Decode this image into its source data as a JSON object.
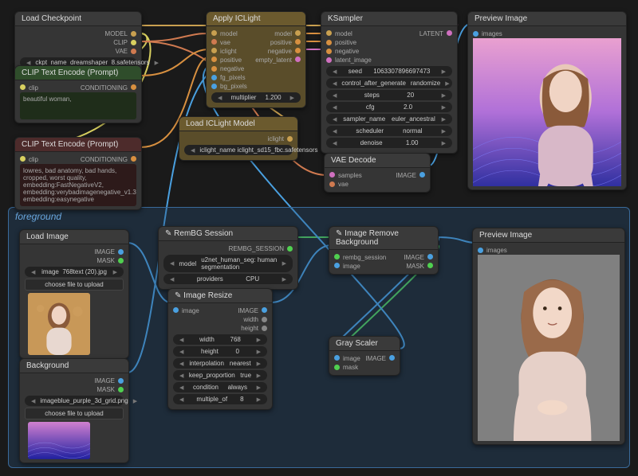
{
  "group": {
    "title": "foreground"
  },
  "loadCheckpoint": {
    "title": "Load Checkpoint",
    "outputs": [
      "MODEL",
      "CLIP",
      "VAE"
    ],
    "widget_label": "ckpt_name",
    "widget_value": "dreamshaper_8.safetensors"
  },
  "clipPos": {
    "title": "CLIP Text Encode (Prompt)",
    "in": "clip",
    "out": "CONDITIONING",
    "text": "beautiful woman,"
  },
  "clipNeg": {
    "title": "CLIP Text Encode (Prompt)",
    "in": "clip",
    "out": "CONDITIONING",
    "text": "lowres, bad anatomy, bad hands, cropped, worst quality, embedding:FastNegativeV2, embedding:verybadimagenegative_v1.3, embedding:easynegative"
  },
  "applyIC": {
    "title": "Apply ICLight",
    "left": [
      "model",
      "vae",
      "iclight",
      "positive",
      "negative",
      "fg_pixels",
      "bg_pixels"
    ],
    "right": [
      "model",
      "positive",
      "negative",
      "empty_latent"
    ],
    "mult_label": "multiplier",
    "mult_value": "1.200"
  },
  "loadIC": {
    "title": "Load ICLight Model",
    "out": "iclight",
    "widget_label": "iclight_name",
    "widget_value": "iclight_sd15_fbc.safetensors"
  },
  "ksampler": {
    "title": "KSampler",
    "left": [
      "model",
      "positive",
      "negative",
      "latent_image"
    ],
    "out": "LATENT",
    "rows": [
      {
        "l": "seed",
        "v": "1063307896697473"
      },
      {
        "l": "control_after_generate",
        "v": "randomize"
      },
      {
        "l": "steps",
        "v": "20"
      },
      {
        "l": "cfg",
        "v": "2.0"
      },
      {
        "l": "sampler_name",
        "v": "euler_ancestral"
      },
      {
        "l": "scheduler",
        "v": "normal"
      },
      {
        "l": "denoise",
        "v": "1.00"
      }
    ]
  },
  "vaeDecode": {
    "title": "VAE Decode",
    "left": [
      "samples",
      "vae"
    ],
    "out": "IMAGE"
  },
  "preview1": {
    "title": "Preview Image",
    "in": "images"
  },
  "loadImage": {
    "title": "Load Image",
    "outs": [
      "IMAGE",
      "MASK"
    ],
    "widget_label": "image",
    "widget_value": "768text (20).jpg",
    "btn": "choose file to upload"
  },
  "background": {
    "title": "Background",
    "outs": [
      "IMAGE",
      "MASK"
    ],
    "widget_label": "image",
    "widget_value": "blue_purple_3d_grid.png",
    "btn": "choose file to upload"
  },
  "rembg": {
    "title": "RemBG Session",
    "out": "REMBG_SESSION",
    "rows": [
      {
        "l": "model",
        "v": "u2net_human_seg: human segmentation"
      },
      {
        "l": "providers",
        "v": "CPU"
      }
    ]
  },
  "imgRemoveBg": {
    "title": "Image Remove Background",
    "left": [
      "rembg_session",
      "image"
    ],
    "right": [
      "IMAGE",
      "MASK"
    ]
  },
  "imgResize": {
    "title": "Image Resize",
    "in": "image",
    "out": "IMAGE",
    "extra_outs": [
      "width",
      "height"
    ],
    "rows": [
      {
        "l": "width",
        "v": "768"
      },
      {
        "l": "height",
        "v": "0"
      },
      {
        "l": "interpolation",
        "v": "nearest"
      },
      {
        "l": "keep_proportion",
        "v": "true"
      },
      {
        "l": "condition",
        "v": "always"
      },
      {
        "l": "multiple_of",
        "v": "8"
      }
    ]
  },
  "grayScaler": {
    "title": "Gray Scaler",
    "left": [
      "image",
      "mask"
    ],
    "out": "IMAGE"
  },
  "preview2": {
    "title": "Preview Image",
    "in": "images"
  }
}
